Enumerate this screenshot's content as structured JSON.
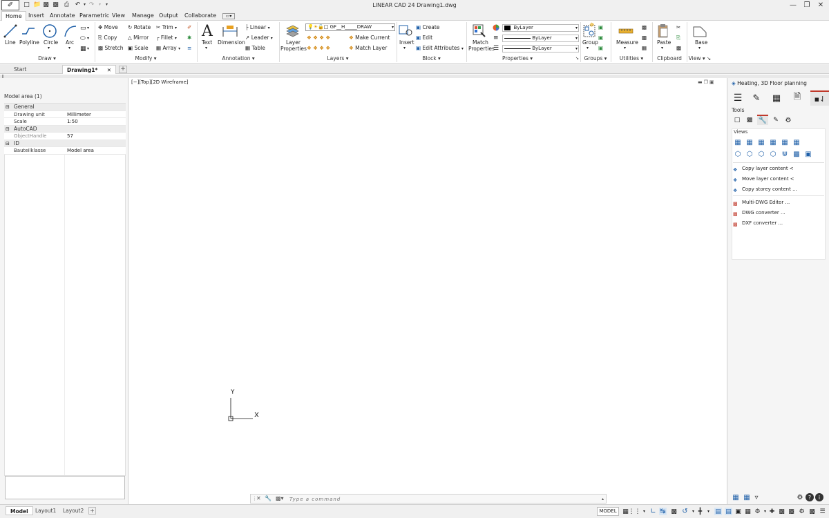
{
  "titlebar": {
    "title": "LINEAR CAD 24    Drawing1.dwg",
    "logo": "linear-logo"
  },
  "menubar": {
    "tabs": [
      "Home",
      "Insert",
      "Annotate",
      "Parametric",
      "View",
      "Manage",
      "Output",
      "Collaborate"
    ]
  },
  "ribbon": {
    "draw": {
      "title": "Draw",
      "line": "Line",
      "polyline": "Polyline",
      "circle": "Circle",
      "arc": "Arc"
    },
    "modify": {
      "title": "Modify",
      "move": "Move",
      "copy": "Copy",
      "stretch": "Stretch",
      "rotate": "Rotate",
      "mirror": "Mirror",
      "scale": "Scale",
      "trim": "Trim",
      "fillet": "Fillet",
      "array": "Array"
    },
    "annotation": {
      "title": "Annotation",
      "text": "Text",
      "dimension": "Dimension",
      "linear": "Linear",
      "leader": "Leader",
      "table": "Table"
    },
    "layers": {
      "title": "Layers",
      "layer_properties_1": "Layer",
      "layer_properties_2": "Properties",
      "layer_name": "GF__H_____DRAW",
      "make_current": "Make Current",
      "match_layer": "Match Layer"
    },
    "block": {
      "title": "Block",
      "insert": "Insert",
      "create": "Create",
      "edit": "Edit",
      "edit_attributes": "Edit Attributes"
    },
    "properties": {
      "title": "Properties",
      "match_1": "Match",
      "match_2": "Properties",
      "color": "ByLayer",
      "linetype": "ByLayer",
      "lineweight": "ByLayer"
    },
    "groups": {
      "title": "Groups",
      "group": "Group"
    },
    "utilities": {
      "title": "Utilities",
      "measure": "Measure"
    },
    "clipboard": {
      "title": "Clipboard",
      "paste": "Paste"
    },
    "view": {
      "title": "View",
      "base": "Base"
    }
  },
  "doctabs": {
    "start": "Start",
    "drawing": "Drawing1*"
  },
  "properties_palette": {
    "header": "Model area (1)",
    "groups": [
      {
        "name": "General",
        "rows": [
          {
            "key": "Drawing unit",
            "value": "Millimeter"
          },
          {
            "key": "Scale",
            "value": "1:50"
          }
        ]
      },
      {
        "name": "AutoCAD",
        "rows": [
          {
            "key": "ObjectHandle",
            "value": "57"
          }
        ]
      },
      {
        "name": "ID",
        "rows": [
          {
            "key": "Bauteilklasse",
            "value": "Model area"
          }
        ]
      }
    ]
  },
  "viewport": {
    "label": "[−][Top][2D Wireframe]",
    "ucs_x": "X",
    "ucs_y": "Y"
  },
  "command": {
    "placeholder": "Type a command"
  },
  "tool_palette": {
    "title": "Heating, 3D Floor planning",
    "tools_label": "Tools",
    "views_label": "Views",
    "items": [
      "Copy layer content <",
      "Move layer content <",
      "Copy storey content ...",
      "Multi-DWG Editor ...",
      "DWG converter ...",
      "DXF converter ..."
    ]
  },
  "layout_tabs": [
    "Model",
    "Layout1",
    "Layout2"
  ],
  "status": {
    "model": "MODEL"
  },
  "colors": {
    "accent": "#1e78c8",
    "active_tab": "#c0392b"
  }
}
